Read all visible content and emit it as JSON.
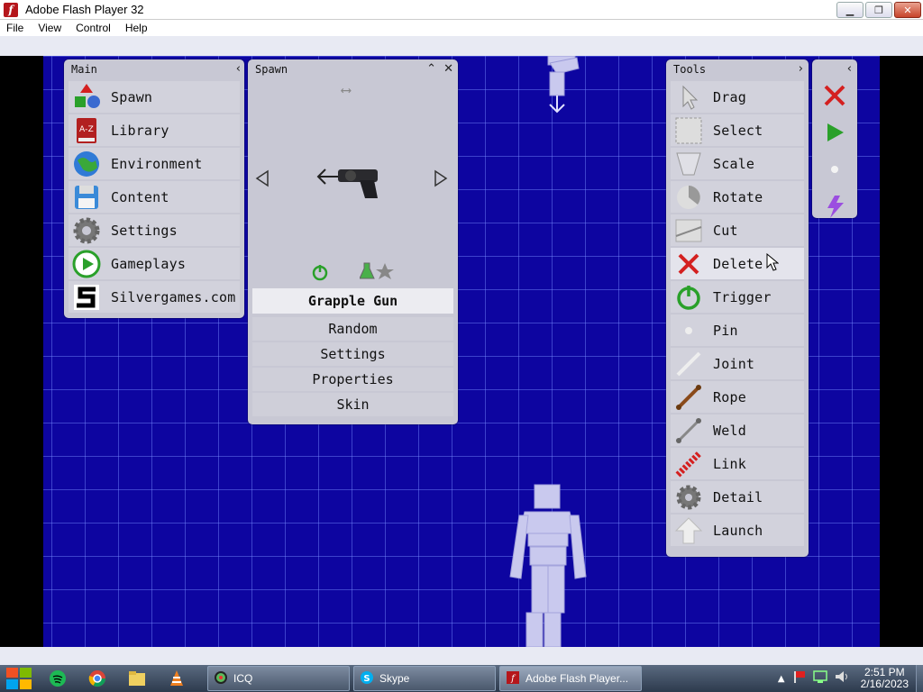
{
  "window": {
    "title": "Adobe Flash Player 32",
    "menu": [
      "File",
      "View",
      "Control",
      "Help"
    ]
  },
  "main_panel": {
    "title": "Main",
    "items": [
      {
        "label": "Spawn",
        "icon": "spawn-shapes-icon"
      },
      {
        "label": "Library",
        "icon": "library-book-icon"
      },
      {
        "label": "Environment",
        "icon": "globe-icon"
      },
      {
        "label": "Content",
        "icon": "floppy-disk-icon"
      },
      {
        "label": "Settings",
        "icon": "gear-icon"
      },
      {
        "label": "Gameplays",
        "icon": "play-icon"
      },
      {
        "label": "Silvergames.com",
        "icon": "silvergames-logo-icon"
      }
    ]
  },
  "spawn_panel": {
    "title": "Spawn",
    "selected_item": "Grapple Gun",
    "buttons": [
      "Random",
      "Settings",
      "Properties",
      "Skin"
    ]
  },
  "tools_panel": {
    "title": "Tools",
    "items": [
      {
        "label": "Drag",
        "icon": "cursor-icon"
      },
      {
        "label": "Select",
        "icon": "select-box-icon"
      },
      {
        "label": "Scale",
        "icon": "scale-icon"
      },
      {
        "label": "Rotate",
        "icon": "rotate-icon"
      },
      {
        "label": "Cut",
        "icon": "cut-icon"
      },
      {
        "label": "Delete",
        "icon": "delete-x-icon"
      },
      {
        "label": "Trigger",
        "icon": "power-icon"
      },
      {
        "label": "Pin",
        "icon": "pin-dot-icon"
      },
      {
        "label": "Joint",
        "icon": "joint-icon"
      },
      {
        "label": "Rope",
        "icon": "rope-icon"
      },
      {
        "label": "Weld",
        "icon": "weld-icon"
      },
      {
        "label": "Link",
        "icon": "link-chain-icon"
      },
      {
        "label": "Detail",
        "icon": "gear-icon"
      },
      {
        "label": "Launch",
        "icon": "launch-arrow-icon"
      }
    ],
    "highlighted": "Delete"
  },
  "taskbar": {
    "apps": [
      "ICQ",
      "Skype",
      "Adobe Flash Player..."
    ],
    "time": "2:51 PM",
    "date": "2/16/2023"
  },
  "colors": {
    "background": "#0d05a0",
    "panel": "#c8c8d4",
    "delete_red": "#d42020",
    "trigger_green": "#2aa02a"
  }
}
